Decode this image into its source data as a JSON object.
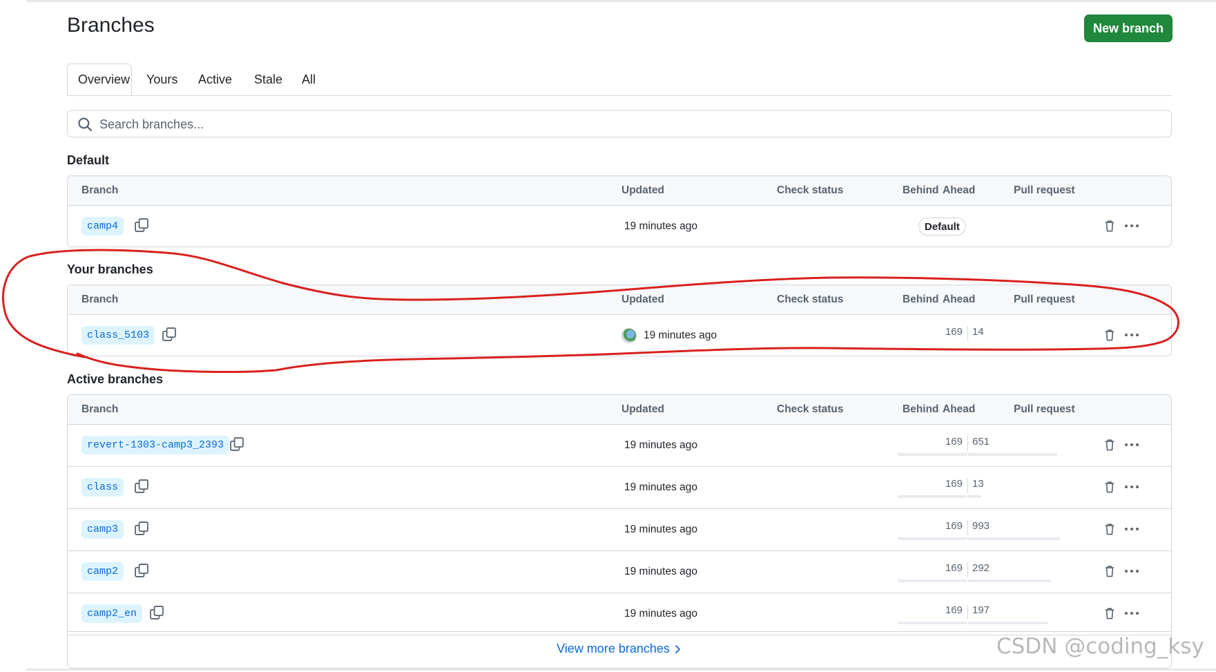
{
  "page": {
    "title": "Branches",
    "new_branch_label": "New branch"
  },
  "tabs": [
    {
      "label": "Overview",
      "selected": true
    },
    {
      "label": "Yours",
      "selected": false
    },
    {
      "label": "Active",
      "selected": false
    },
    {
      "label": "Stale",
      "selected": false
    },
    {
      "label": "All",
      "selected": false
    }
  ],
  "search": {
    "placeholder": "Search branches..."
  },
  "columns": {
    "branch": "Branch",
    "updated": "Updated",
    "check_status": "Check status",
    "behind": "Behind",
    "ahead": "Ahead",
    "pull_request": "Pull request"
  },
  "sections": {
    "default": {
      "title": "Default",
      "rows": [
        {
          "name": "camp4",
          "updated": "19 minutes ago",
          "badge": "Default"
        }
      ]
    },
    "yours": {
      "title": "Your branches",
      "rows": [
        {
          "name": "class_5103",
          "updated": "19 minutes ago",
          "behind": "169",
          "ahead": "14",
          "has_avatar": true
        }
      ]
    },
    "active": {
      "title": "Active branches",
      "rows": [
        {
          "name": "revert-1303-camp3_2393",
          "updated": "19 minutes ago",
          "behind": "169",
          "ahead": "651"
        },
        {
          "name": "class",
          "updated": "19 minutes ago",
          "behind": "169",
          "ahead": "13"
        },
        {
          "name": "camp3",
          "updated": "19 minutes ago",
          "behind": "169",
          "ahead": "993"
        },
        {
          "name": "camp2",
          "updated": "19 minutes ago",
          "behind": "169",
          "ahead": "292"
        },
        {
          "name": "camp2_en",
          "updated": "19 minutes ago",
          "behind": "169",
          "ahead": "197"
        }
      ],
      "view_more_label": "View more branches"
    }
  },
  "icons": {
    "search": "search-icon",
    "copy": "copy-icon",
    "trash": "trash-icon",
    "more": "kebab-horizontal-icon",
    "chevron": "chevron-right-icon"
  },
  "colors": {
    "accent": "#1f883d",
    "link": "#0969da",
    "annotation": "#d9201e"
  },
  "watermark": "CSDN @coding_ksy"
}
